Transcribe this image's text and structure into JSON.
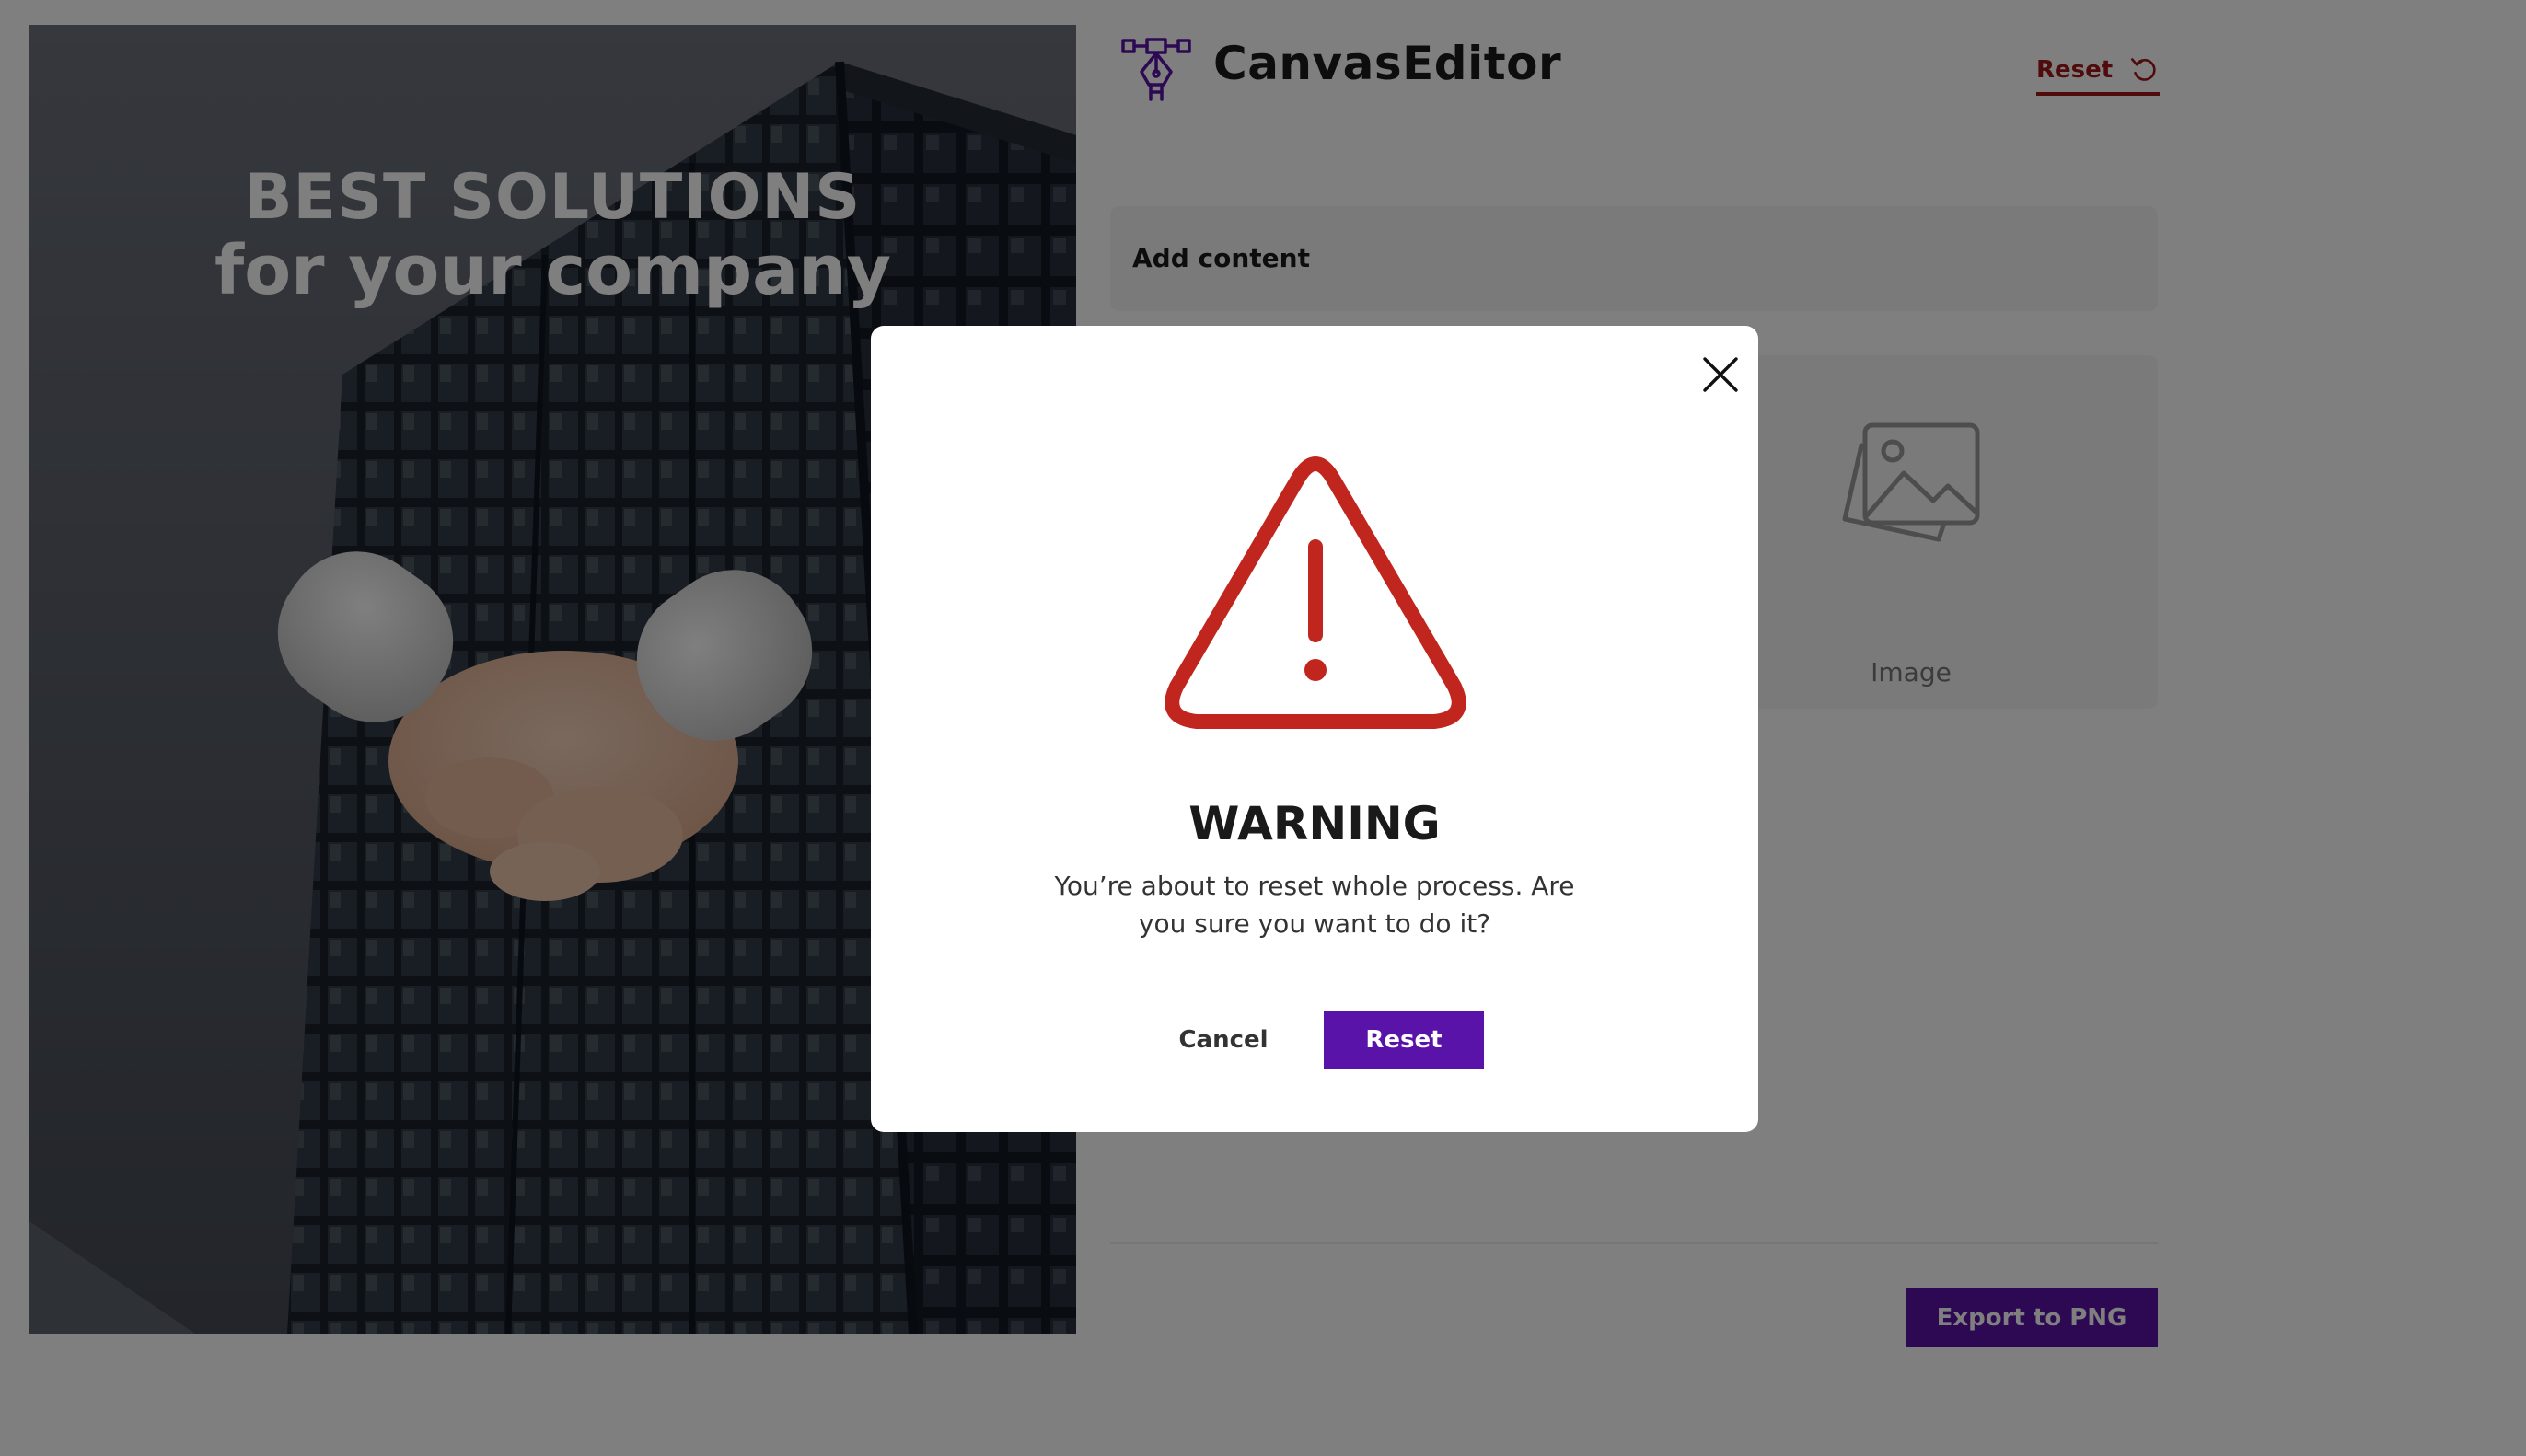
{
  "canvas": {
    "title_line1": "BEST SOLUTIONS",
    "title_line2": "for your company",
    "background_image": "office-building-photo",
    "sticker": "handshake-sticker"
  },
  "header": {
    "app_title": "CanvasEditor",
    "logo_icon": "pen-tool-icon",
    "reset_label": "Reset",
    "reset_icon": "rotate-ccw-icon"
  },
  "panel": {
    "add_content_label": "Add content",
    "image_tile_label": "Image",
    "image_tile_icon": "image-icon",
    "export_label": "Export to PNG"
  },
  "modal": {
    "title": "WARNING",
    "message": "You’re about to reset whole process. Are you sure you want to do it?",
    "cancel_label": "Cancel",
    "confirm_label": "Reset",
    "warning_icon": "warning-triangle-icon",
    "close_icon": "close-icon"
  },
  "colors": {
    "accent": "#5a13a8",
    "danger": "#c0261d",
    "reset_link": "#a01818",
    "overlay": "rgba(0,0,0,0.5)"
  }
}
